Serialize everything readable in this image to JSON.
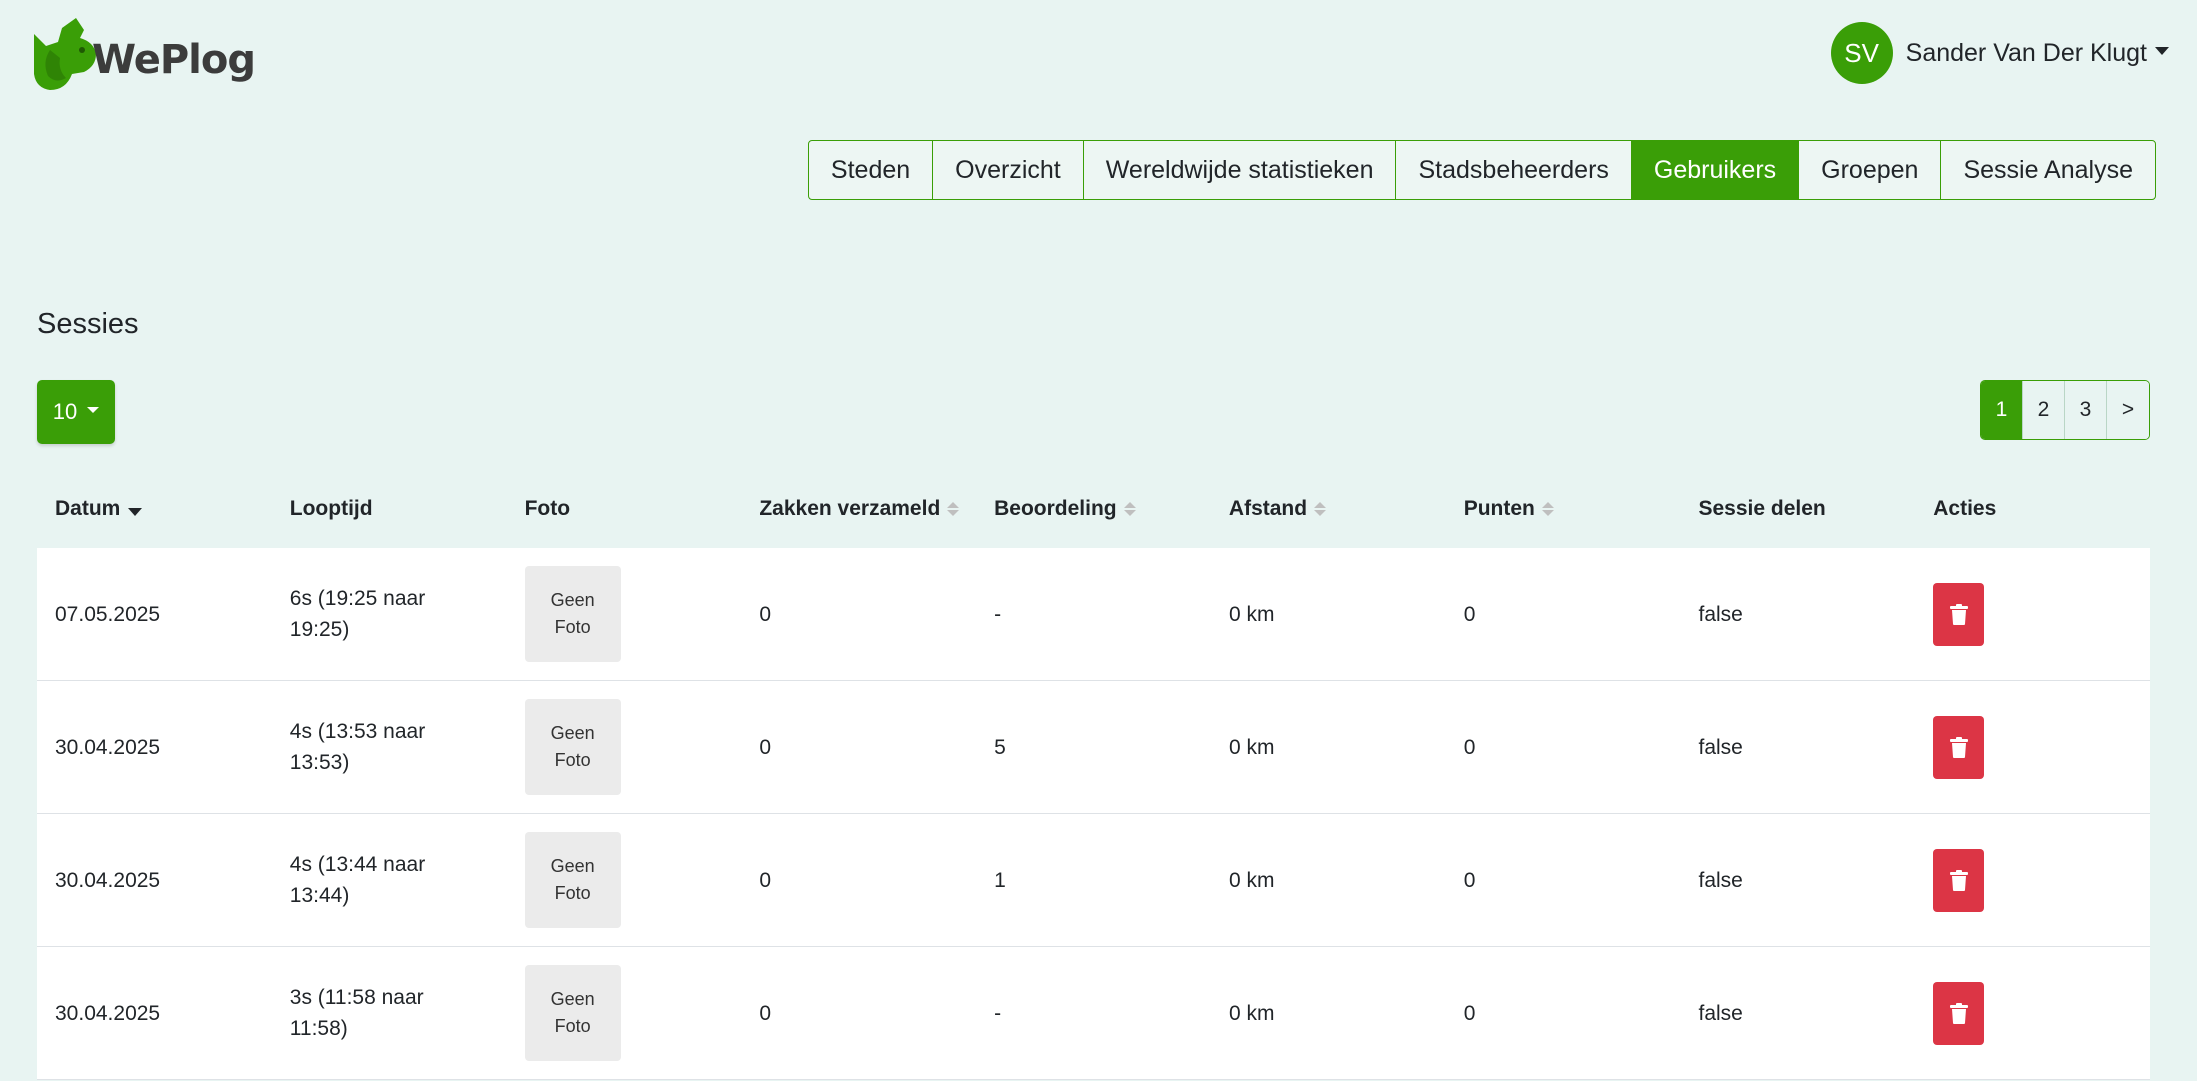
{
  "app": {
    "logo_text": "WePlog",
    "brand_color": "#3a9e07"
  },
  "user": {
    "initials": "SV",
    "name": "Sander Van Der Klugt"
  },
  "nav": {
    "tabs": [
      {
        "label": "Steden",
        "active": false
      },
      {
        "label": "Overzicht",
        "active": false
      },
      {
        "label": "Wereldwijde statistieken",
        "active": false
      },
      {
        "label": "Stadsbeheerders",
        "active": false
      },
      {
        "label": "Gebruikers",
        "active": true
      },
      {
        "label": "Groepen",
        "active": false
      },
      {
        "label": "Sessie Analyse",
        "active": false
      }
    ]
  },
  "section": {
    "title": "Sessies",
    "page_size": "10"
  },
  "pagination": {
    "pages": [
      "1",
      "2",
      "3"
    ],
    "current": "1",
    "next_label": ">"
  },
  "table": {
    "headers": {
      "date": "Datum",
      "duration": "Looptijd",
      "photo": "Foto",
      "bags": "Zakken verzameld",
      "rating": "Beoordeling",
      "distance": "Afstand",
      "points": "Punten",
      "share": "Sessie delen",
      "actions": "Acties"
    },
    "rows": [
      {
        "date": "07.05.2025",
        "duration": "6s (19:25 naar 19:25)",
        "photo": "Geen Foto",
        "bags": "0",
        "rating": "-",
        "distance": "0 km",
        "points": "0",
        "share": "false"
      },
      {
        "date": "30.04.2025",
        "duration": "4s (13:53 naar 13:53)",
        "photo": "Geen Foto",
        "bags": "0",
        "rating": "5",
        "distance": "0 km",
        "points": "0",
        "share": "false"
      },
      {
        "date": "30.04.2025",
        "duration": "4s (13:44 naar 13:44)",
        "photo": "Geen Foto",
        "bags": "0",
        "rating": "1",
        "distance": "0 km",
        "points": "0",
        "share": "false"
      },
      {
        "date": "30.04.2025",
        "duration": "3s (11:58 naar 11:58)",
        "photo": "Geen Foto",
        "bags": "0",
        "rating": "-",
        "distance": "0 km",
        "points": "0",
        "share": "false"
      }
    ]
  },
  "icons": {
    "delete": "trash-icon",
    "logo": "squirrel-logo-icon"
  }
}
